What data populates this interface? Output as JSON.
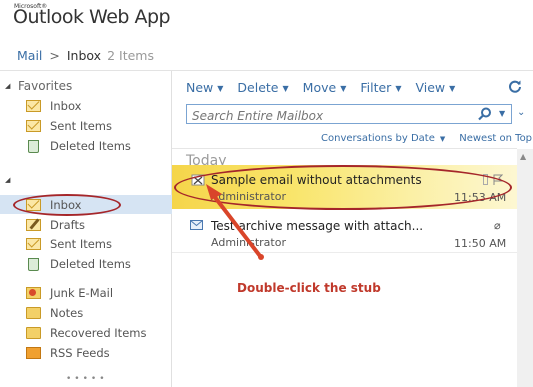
{
  "brand": {
    "ms": "Microsoft®",
    "app": "Outlook Web App"
  },
  "breadcrumb": {
    "root": "Mail",
    "sep": ">",
    "current": "Inbox",
    "count": "2 Items"
  },
  "favorites": {
    "heading": "Favorites",
    "items": [
      {
        "label": "Inbox",
        "icon": "inbox-folder-icon"
      },
      {
        "label": "Sent Items",
        "icon": "sent-folder-icon"
      },
      {
        "label": "Deleted Items",
        "icon": "trash-icon"
      }
    ]
  },
  "mailbox": {
    "items": [
      {
        "label": "Inbox",
        "icon": "inbox-folder-icon",
        "selected": true
      },
      {
        "label": "Drafts",
        "icon": "drafts-icon"
      },
      {
        "label": "Sent Items",
        "icon": "sent-folder-icon"
      },
      {
        "label": "Deleted Items",
        "icon": "trash-icon"
      },
      {
        "label": "Junk E-Mail",
        "icon": "junk-icon"
      },
      {
        "label": "Notes",
        "icon": "notes-folder-icon"
      },
      {
        "label": "Recovered Items",
        "icon": "folder-icon"
      },
      {
        "label": "RSS Feeds",
        "icon": "rss-icon"
      }
    ]
  },
  "toolbar": {
    "new": "New",
    "delete": "Delete",
    "move": "Move",
    "filter": "Filter",
    "view": "View"
  },
  "search": {
    "placeholder": "Search Entire Mailbox"
  },
  "sort": {
    "by": "Conversations by Date",
    "order": "Newest on Top"
  },
  "group": {
    "label": "Today"
  },
  "messages": [
    {
      "subject": "Sample email without attachments",
      "from": "Administrator",
      "time": "11:53 AM",
      "icon": "stub-icon",
      "highlighted": true
    },
    {
      "subject": "Test archive message with attach...",
      "from": "Administrator",
      "time": "11:50 AM",
      "icon": "envelope-icon",
      "attachment": true
    }
  ],
  "annotation": {
    "caption": "Double-click the stub"
  },
  "colors": {
    "accent": "#3a6ea5",
    "highlight": "#f9e56b",
    "annotation": "#c0392b",
    "selected": "#d6e4f3"
  }
}
